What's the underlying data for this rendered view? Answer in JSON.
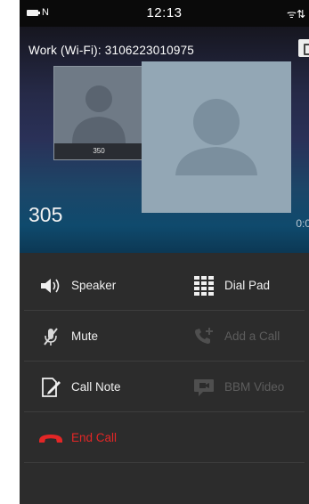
{
  "status_bar": {
    "carrier": "N",
    "time": "12:13",
    "right_icons": "ᯤ⇅"
  },
  "call": {
    "line_label": "Work (Wi-Fi): 3106223010975",
    "small_contact_label": "350",
    "caller_number": "305",
    "timer": "0:0"
  },
  "actions": {
    "speaker": "Speaker",
    "dial_pad": "Dial Pad",
    "mute": "Mute",
    "add_call": "Add a Call",
    "call_note": "Call Note",
    "bbm_video": "BBM Video",
    "end_call": "End Call"
  },
  "colors": {
    "end_call_red": "#e32626",
    "disabled_gray": "#5d5d5d",
    "panel": "#2c2c2c"
  }
}
